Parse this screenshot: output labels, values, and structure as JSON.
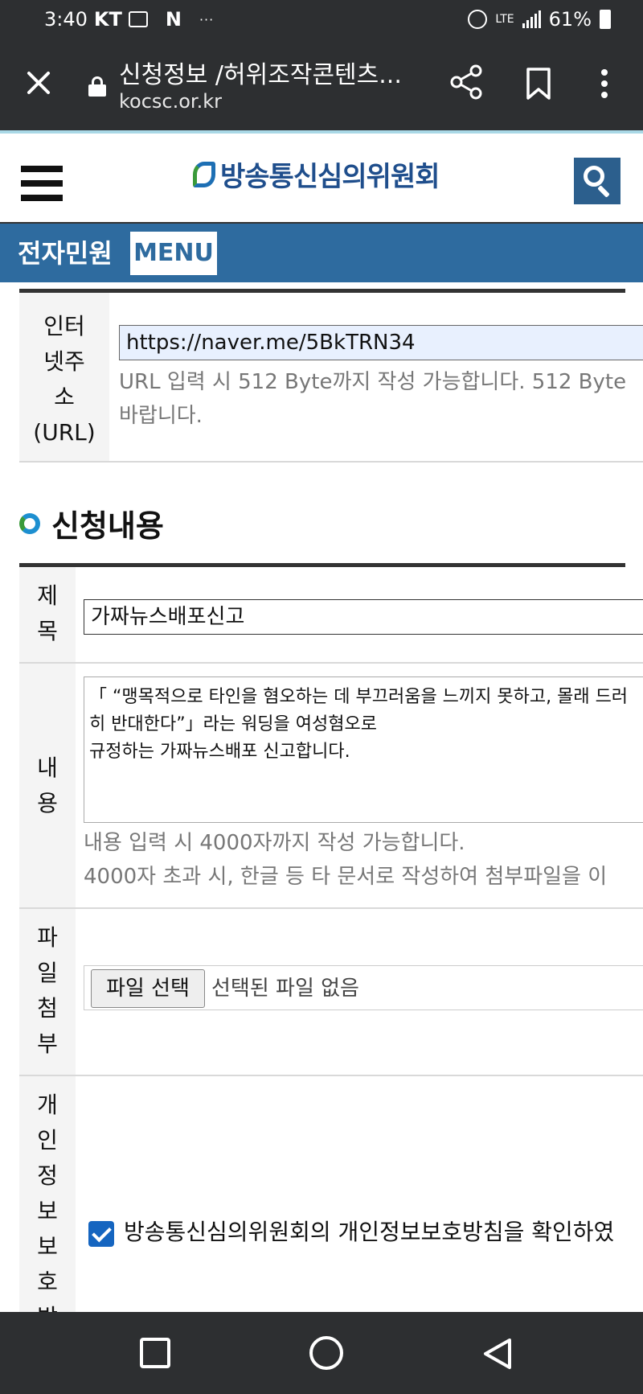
{
  "status_bar": {
    "time": "3:40",
    "carrier": "KT",
    "notif_n": "N",
    "dots": "···",
    "network": "LTE",
    "battery": "61%"
  },
  "browser": {
    "title": "신청정보 /허위조작콘텐츠...",
    "url": "kocsc.or.kr"
  },
  "site": {
    "logo_text": "방송통신심의위원회",
    "menu_title": "전자민원",
    "menu_button": "MENU"
  },
  "form": {
    "url_row": {
      "label": [
        "인터",
        "넷주",
        "소",
        "(URL)"
      ],
      "value": "https://naver.me/5BkTRN34",
      "help": [
        "URL 입력 시 512 Byte까지 작성 가능합니다. 512 Byte",
        "바랍니다."
      ]
    },
    "section_title": "신청내용",
    "title_row": {
      "label": [
        "제",
        "목"
      ],
      "value": "가짜뉴스배포신고"
    },
    "content_row": {
      "label": [
        "내",
        "용"
      ],
      "lines": [
        "「 “맹목적으로 타인을 혐오하는 데 부끄러움을 느끼지 못하고, 몰래 드러",
        "히 반대한다”」라는 워딩을 여성혐오로",
        "규정하는 가짜뉴스배포 신고합니다."
      ],
      "help": [
        "내용 입력 시 4000자까지 작성 가능합니다.",
        "4000자 초과 시, 한글 등 타 문서로 작성하여 첨부파일을 이"
      ]
    },
    "file_row": {
      "label": [
        "파",
        "일",
        "첨",
        "부"
      ],
      "button": "파일 선택",
      "status": "선택된 파일 없음"
    },
    "privacy_row": {
      "label": [
        "개",
        "인",
        "정",
        "보",
        "보",
        "호",
        "방"
      ],
      "text": "방송통신심의위원회의 개인정보보호방침을 확인하였"
    }
  }
}
